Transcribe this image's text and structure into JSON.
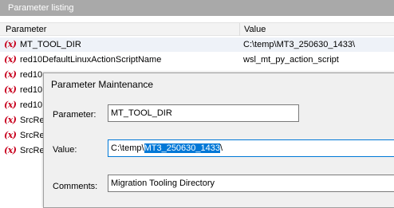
{
  "panel": {
    "title": "Parameter listing"
  },
  "columns": {
    "parameter": "Parameter",
    "value": "Value"
  },
  "rows": [
    {
      "icon": "(x)",
      "name": "MT_TOOL_DIR",
      "value": "C:\\temp\\MT3_250630_1433\\",
      "selected": true
    },
    {
      "icon": "(x)",
      "name": "red10DefaultLinuxActionScriptName",
      "value": "wsl_mt_py_action_script"
    },
    {
      "icon": "(x)",
      "name": "red10",
      "value": ""
    },
    {
      "icon": "(x)",
      "name": "red10",
      "value": ""
    },
    {
      "icon": "(x)",
      "name": "red10",
      "value": ""
    },
    {
      "icon": "(x)",
      "name": "SrcRe",
      "value": ""
    },
    {
      "icon": "(x)",
      "name": "SrcRe",
      "value": ""
    },
    {
      "icon": "(x)",
      "name": "SrcRe",
      "value": ""
    }
  ],
  "dialog": {
    "title": "Parameter Maintenance",
    "parameter_label": "Parameter:",
    "parameter_value": "MT_TOOL_DIR",
    "value_label": "Value:",
    "value_prefix": "C:\\temp\\",
    "value_selected": "MT3_250630_1433",
    "value_suffix": "\\",
    "comments_label": "Comments:",
    "comments_value": "Migration Tooling Directory"
  },
  "colors": {
    "icon": "#c8001e",
    "selection": "#0078d7",
    "panel_title": "#a9a9a9"
  }
}
